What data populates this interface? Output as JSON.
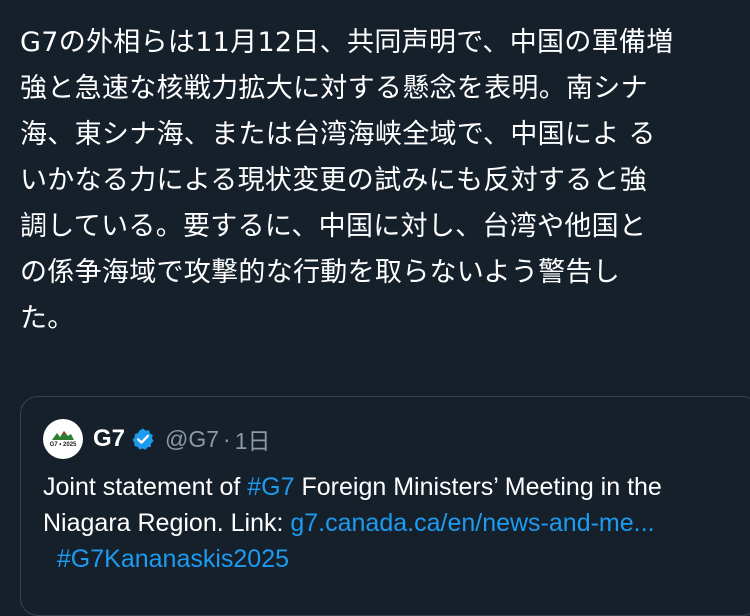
{
  "tweet": {
    "text": "G7の外相らは11月12日、共同声明で、中国の軍備増\n強と急速な核戦力拡大に対する懸念を表明。南シナ\n海、東シナ海、または台湾海峡全域で、中国によ る\nいかなる力による現状変更の試みにも反対すると強\n調している。要するに、中国に対し、台湾や他国と\nの係争海域で攻撃的な行動を取らないよう警告し\nた。"
  },
  "quote": {
    "avatar_text": "G7 • 2025",
    "name": "G7",
    "handle": "@G7",
    "dot": "·",
    "time": "1日",
    "text_1": "Joint statement of ",
    "hashtag_1": "#G7",
    "text_2": " Foreign Ministers’ Meeting in the Niagara Region. Link: ",
    "link": "g7.canada.ca/en/news-and-me...",
    "text_3": "  ",
    "hashtag_2": "#G7Kananaskis2025"
  },
  "colors": {
    "background": "#15202b",
    "text": "#ffffff",
    "muted": "#8b98a5",
    "link": "#1d9bf0",
    "border": "#38444d",
    "verified": "#1d9bf0"
  },
  "icons": {
    "verified": "verified-badge-icon",
    "avatar": "g7-logo"
  }
}
